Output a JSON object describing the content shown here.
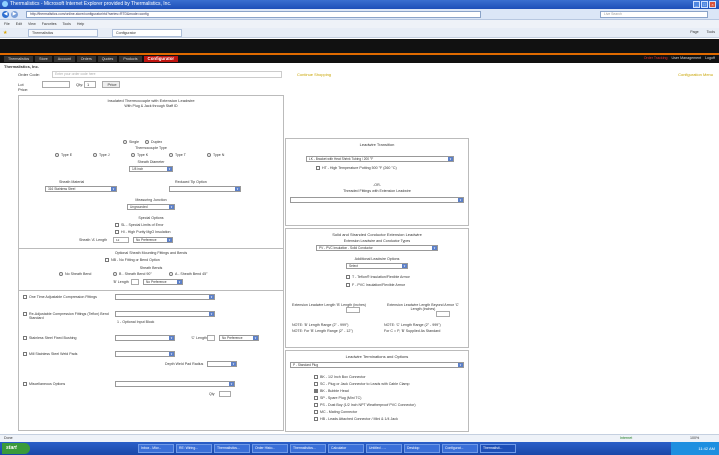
{
  "window": {
    "title": "Thermalistics - Microsoft Internet Explorer provided by Thermalistics, Inc.",
    "url": "http://thermalistics.com/online-store/configurator/rtd?series=RTD&mode=config",
    "search_placeholder": "Live Search"
  },
  "menu": [
    "File",
    "Edit",
    "View",
    "Favorites",
    "Tools",
    "Help"
  ],
  "tabs": [
    "Thermalistics",
    "Configurator"
  ],
  "toolbar": [
    "Page",
    "Tools"
  ],
  "app_nav": {
    "items": [
      "Thermalistics",
      "Store",
      "Account",
      "Orders",
      "Quotes",
      "Products"
    ],
    "active": "Configurator",
    "user_links": [
      "Order Tracking",
      "User Management",
      "Logoff"
    ]
  },
  "company": "Thermalistics, Inc.",
  "order_code": {
    "label": "Order Code:",
    "placeholder": "Enter your order code here",
    "link": "Continue Shopping",
    "right_link": "Configuration Menu"
  },
  "lot": {
    "label": "Lot Price:",
    "qty_label": "Qty:",
    "qty": "1",
    "button": "Price"
  },
  "left": {
    "heading1": "Insulated Thermocouple with Extension Leadwire",
    "heading2": "With Plug & Jack through Staff ID",
    "element_options": [
      "Single",
      "Duplex"
    ],
    "thermocouple_type_label": "Thermocouple Type",
    "types": [
      "Type E",
      "Type J",
      "Type K",
      "Type T",
      "Type N"
    ],
    "sheath_diameter_label": "Sheath Diameter",
    "sheath_diameter_value": "1/8 inch",
    "sheath_material_label": "Sheath Material",
    "sheath_material_value": "316 Stainless Steel",
    "reduced_tip_label": "Reduced Tip Option",
    "measuring_junction_label": "Measuring Junction",
    "measuring_junction_value": "Ungrounded",
    "special_options_label": "Special Options",
    "special_options": [
      "SL - Special Limits of Error",
      "HI - High Purity MgO Insulation"
    ],
    "sheath_length_label": "Sheath 'A' Length",
    "sheath_length_value": "12",
    "sheath_length_unit": "No Preference",
    "sheath_bends_heading": "Optional Sheath Mounting Fittings and Bends",
    "no_bends_label": "NB - No Fitting or Bend Option",
    "sheath_bends_label": "Sheath Bends",
    "bend_options": [
      "No Sheath Bend",
      "B - Sheath Bend 90°",
      "A - Sheath Bend 45°"
    ],
    "bend_length_label": "'B' Length",
    "bend_length_unit": "No Preference",
    "fitting_options": [
      "One Time Adjustable Compression Fittings",
      "Re-Adjustable Compression Fittings (Teflon) Bend Standard",
      "Stainless Steel Fixed Bushing",
      "Mill Stainless Steel Weld Pads",
      "Miscellaneous Options"
    ],
    "optional_input_label": "1 - Optional Input Block",
    "c_length_label": "'C' Length",
    "no_preference": "No Preference",
    "depth_label": "Depth Weld Pad Radius",
    "qty_label": "Qty"
  },
  "right": {
    "leadwire_transition_label": "Leadwire Transition",
    "transition_value": "LK - Bracket with Heat Shrink Tubing / 200 °F",
    "transition_option": "HT - High Temperature Potting 500 °F (260 °C)",
    "or_label": "-OR-",
    "threaded_label": "Threaded Fittings with Extension Leadwire",
    "solid_heading": "Solid and Stranded Conductor Extension Leadwire",
    "ext_leadwire_label": "Extension Leadwire and Conductor Types",
    "ext_leadwire_value": "PV - PVC Insulation - Solid Conductor",
    "additional_label": "Additional Leadwire Options",
    "additional_value": "Select",
    "additional_options": [
      "T - Teflon® Insulation/Flexible Armor",
      "F - PVC Insulation/Flexible Armor"
    ],
    "length_label_left": "Extension Leadwire Length 'B' Length (inches)",
    "length_label_right": "Extension Leadwire Length Beyond Armor 'C' Length (inches)",
    "note_left": "NOTE: 'B' Length Range (2\" - 999\")",
    "note_right": "NOTE: 'C' Length Range (2\" - 999\")",
    "note_left2": "NOTE: For 'B' Length Range (2\" - 12\")",
    "note_right2": "For C = P, 'B' Supplied As Standard",
    "terminations_label": "Leadwire Terminations and Options",
    "terminations_value": "P - Standard Plug",
    "termination_options": [
      "BK - 1/2 Inch Box Connector",
      "SC - Plug or Jack Connector to Leads with Cable Clamp",
      "BK - Bubble Head",
      "SP - Spare Plug (Mini TC)",
      "PS - Dust Boy (1/2 Inch NPT Weatherproof PVC Connector)",
      "MC - Mating Connector",
      "HB - Leads Attached Connector / Mini & 1/4 Jack"
    ]
  },
  "status": {
    "left": "Done",
    "zone": "Internet",
    "zoom": "100%"
  },
  "taskbar": {
    "start": "start",
    "items": [
      "Inbox - Micr...",
      "RE: Wiring...",
      "Thermalistics...",
      "Order Histo...",
      "Thermalistics...",
      "Calculator",
      "Untitled - ...",
      "Desktop",
      "Configurat...",
      "Thermalisti..."
    ],
    "clock": "11:42 AM"
  }
}
